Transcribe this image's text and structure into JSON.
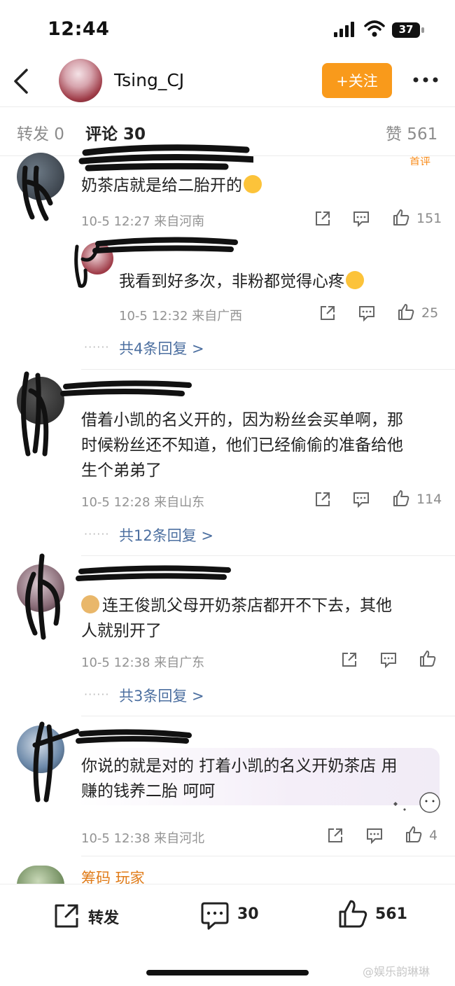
{
  "status_bar": {
    "time": "12:44",
    "battery": "37"
  },
  "nav": {
    "username": "Tsing_CJ",
    "follow_label": "+关注"
  },
  "tabs": {
    "repost": "转发 0",
    "comments": "评论 30",
    "likes": "赞 561"
  },
  "comments": [
    {
      "text": "奶茶店就是给二胎开的",
      "meta": "10-5 12:27 来自河南",
      "likes": "151",
      "partial_badge": "首评",
      "reply": {
        "text": "我看到好多次，非粉都觉得心疼",
        "meta": "10-5 12:32 来自广西",
        "likes": "25"
      },
      "replies_link": "共4条回复 >"
    },
    {
      "text_lines": [
        "借着小凯的名义开的，因为粉丝会买单啊，那",
        "时候粉丝还不知道，他们已经偷偷的准备给他",
        "生个弟弟了"
      ],
      "meta": "10-5 12:28 来自山东",
      "likes": "114",
      "replies_link": "共12条回复 >"
    },
    {
      "text_lines": [
        "连王俊凯父母开奶茶店都开不下去，其他",
        "人就别开了"
      ],
      "meta": "10-5 12:38 来自广东",
      "replies_link": "共3条回复 >"
    },
    {
      "text_lines": [
        "你说的就是对的 打着小凯的名义开奶茶店 用",
        "赚的钱养二胎 呵呵"
      ],
      "meta": "10-5 12:38 来自河北",
      "likes": "4"
    },
    {
      "name_partial": "筹码 玩家"
    }
  ],
  "bottom_bar": {
    "repost_label": "转发",
    "comment_count": "30",
    "like_count": "561"
  },
  "watermark": "@娱乐韵琳琳",
  "colors": {
    "accent": "#f99a1b",
    "link": "#4c6fa0",
    "meta": "#939393"
  }
}
